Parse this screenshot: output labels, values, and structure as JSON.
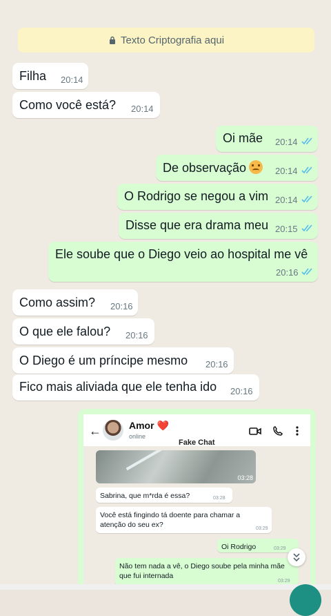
{
  "banner": {
    "icon": "lock-icon",
    "text": "Texto Criptografia aqui"
  },
  "messages": [
    {
      "dir": "in",
      "text": "Filha",
      "time": "20:14"
    },
    {
      "dir": "in",
      "text": "Como você está?",
      "time": "20:14"
    },
    {
      "dir": "out",
      "text": "Oi mãe",
      "time": "20:14",
      "read": true
    },
    {
      "dir": "out",
      "text": "De observação",
      "emoji": "persevering-face-emoji",
      "time": "20:14",
      "read": true
    },
    {
      "dir": "out",
      "text": "O Rodrigo se negou a vim",
      "time": "20:14",
      "read": true
    },
    {
      "dir": "out",
      "text": "Disse que era drama meu",
      "time": "20:15",
      "read": true
    },
    {
      "dir": "out",
      "text": "Ele soube que o Diego veio ao hospital me vê",
      "time": "20:16",
      "read": true
    },
    {
      "dir": "in",
      "text": "Como assim?",
      "time": "20:16"
    },
    {
      "dir": "in",
      "text": "O que ele falou?",
      "time": "20:16"
    },
    {
      "dir": "in",
      "text": "O Diego é um príncipe mesmo",
      "time": "20:16"
    },
    {
      "dir": "in",
      "text": "Fico mais aliviada que ele tenha ido",
      "time": "20:16"
    }
  ],
  "embedded_screenshot": {
    "contact_name": "Amor",
    "contact_emoji": "❤️",
    "contact_status": "online",
    "label": "Fake Chat",
    "photo_time": "03:28",
    "messages": [
      {
        "dir": "in",
        "text": "Sabrina, que m*rda é essa?",
        "time": "03:28"
      },
      {
        "dir": "in",
        "text": "Você está fingindo tá doente para chamar a atenção do seu ex?",
        "time": "03:29"
      },
      {
        "dir": "out",
        "text": "Oi Rodrigo",
        "time": "03:29"
      },
      {
        "dir": "out",
        "text": "Não tem nada a vê, o Diego soube pela minha mãe que fui internada",
        "time": "03:29"
      }
    ]
  },
  "colors": {
    "incoming": "#ffffff",
    "outgoing": "#d9fdd3",
    "tick": "#53bdeb",
    "background": "#efeae2",
    "banner": "#fcf4c4"
  }
}
